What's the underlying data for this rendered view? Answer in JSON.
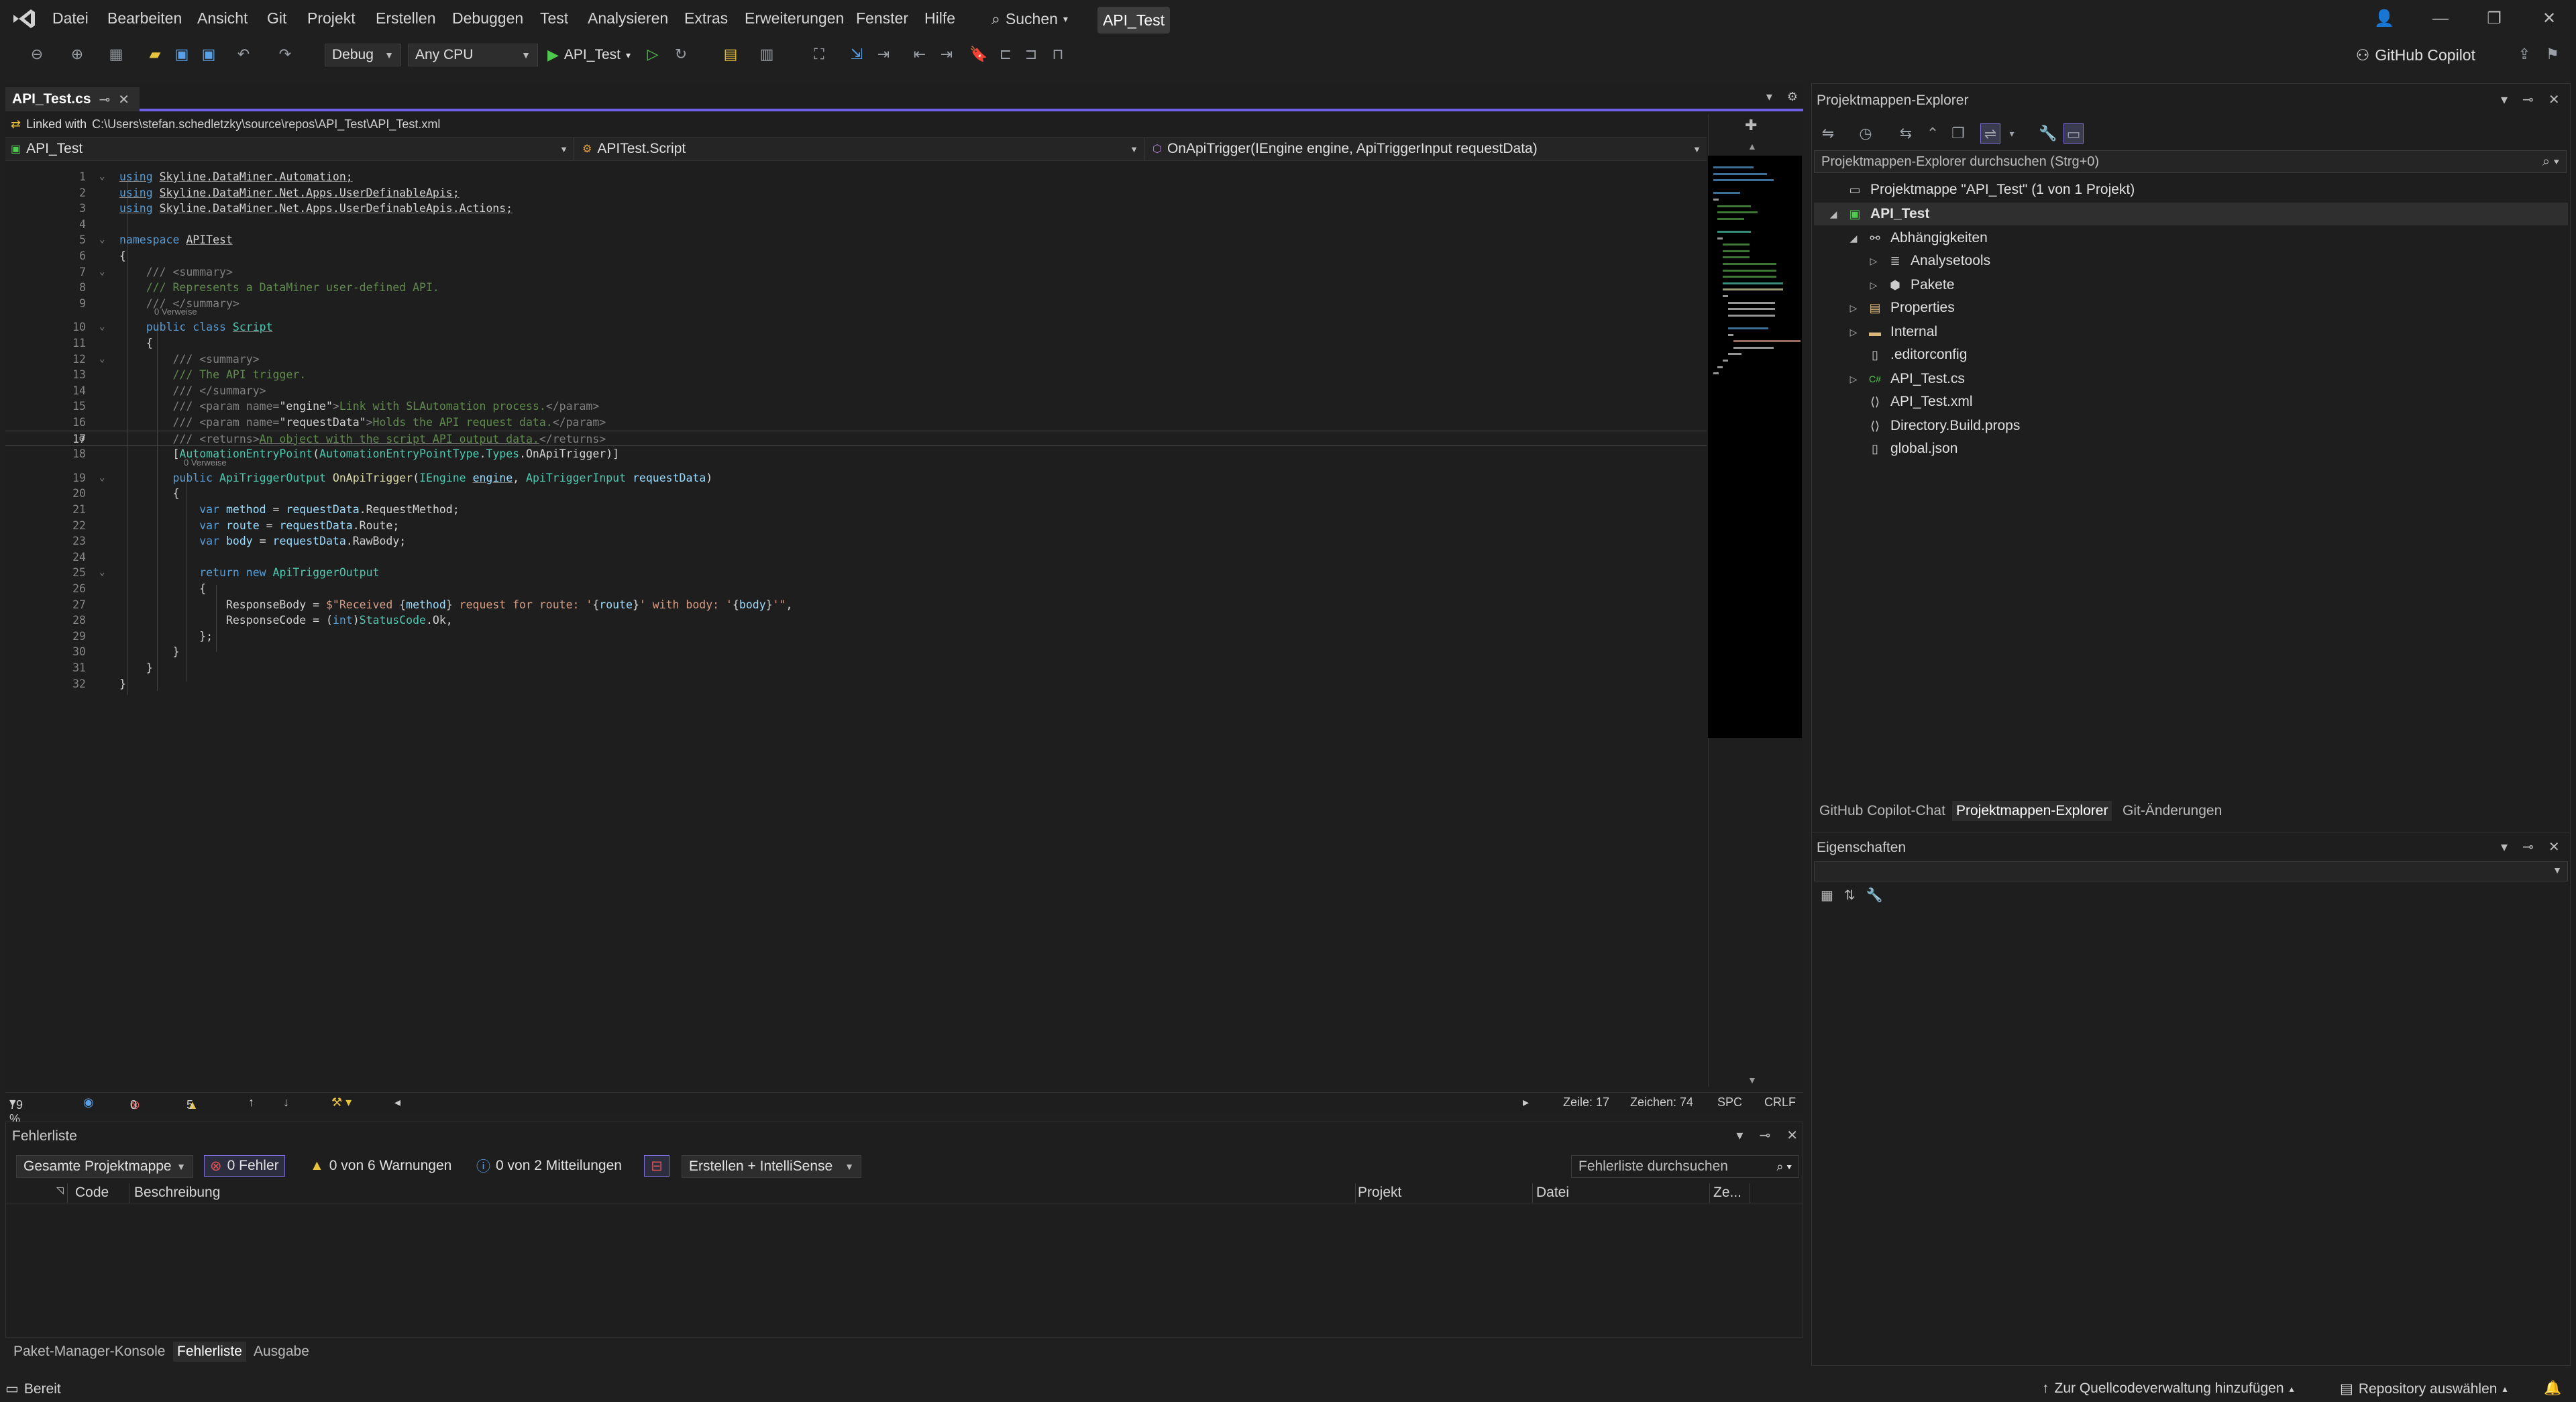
{
  "menu": {
    "items": [
      "Datei",
      "Bearbeiten",
      "Ansicht",
      "Git",
      "Projekt",
      "Erstellen",
      "Debuggen",
      "Test",
      "Analysieren",
      "Extras",
      "Erweiterungen",
      "Fenster",
      "Hilfe"
    ],
    "search_label": "Suchen",
    "project_name": "API_Test"
  },
  "toolbar": {
    "config": "Debug",
    "platform": "Any CPU",
    "run_label": "API_Test",
    "copilot_label": "GitHub Copilot"
  },
  "editor": {
    "tab_title": "API_Test.cs",
    "linked_label": "Linked with",
    "linked_path": "C:\\Users\\stefan.schedletzky\\source\\repos\\API_Test\\API_Test.xml",
    "nav_project": "API_Test",
    "nav_class": "APITest.Script",
    "nav_member": "OnApiTrigger(IEngine engine, ApiTriggerInput requestData)",
    "current_line": 17,
    "ref_label": "0 Verweise",
    "status": {
      "zoom": "79 %",
      "errors": "0",
      "warnings": "5",
      "line": "Zeile: 17",
      "char": "Zeichen: 74",
      "spc": "SPC",
      "crlf": "CRLF"
    }
  },
  "code_lines": [
    {
      "n": 1,
      "html": "<span class='kw ul'>using</span> <span class='ul'>Skyline.DataMiner.Automation;</span>"
    },
    {
      "n": 2,
      "html": "<span class='kw ul'>using</span> <span class='ul'>Skyline.DataMiner.Net.Apps.UserDefinableApis;</span>"
    },
    {
      "n": 3,
      "html": "<span class='kw ul'>using</span> <span class='ul'>Skyline.DataMiner.Net.Apps.UserDefinableApis.Actions;</span>"
    },
    {
      "n": 4,
      "html": ""
    },
    {
      "n": 5,
      "html": "<span class='kw'>namespace</span> <span class='ul'>APITest</span>"
    },
    {
      "n": 6,
      "html": "{"
    },
    {
      "n": 7,
      "html": "    <span class='xmltag'>///</span> <span class='xmltag'>&lt;summary&gt;</span>"
    },
    {
      "n": 8,
      "html": "    <span class='xml'>/// Represents a DataMiner user-defined API.</span>"
    },
    {
      "n": 9,
      "html": "    <span class='xmltag'>/// &lt;/summary&gt;</span>"
    },
    {
      "n": 10,
      "html": "    <span class='kw'>public</span> <span class='kw'>class</span> <span class='ty ul'>Script</span>"
    },
    {
      "n": 11,
      "html": "    {"
    },
    {
      "n": 12,
      "html": "        <span class='xmltag'>/// &lt;summary&gt;</span>"
    },
    {
      "n": 13,
      "html": "        <span class='xml'>/// The API trigger.</span>"
    },
    {
      "n": 14,
      "html": "        <span class='xmltag'>/// &lt;/summary&gt;</span>"
    },
    {
      "n": 15,
      "html": "        <span class='xmltag'>/// &lt;param</span> <span class='xmltag'>name=</span><span class='nm'>\"engine\"</span><span class='xmltag'>&gt;</span><span class='xml'>Link with SLAutomation process.</span><span class='xmltag'>&lt;/param&gt;</span>"
    },
    {
      "n": 16,
      "html": "        <span class='xmltag'>/// &lt;param</span> <span class='xmltag'>name=</span><span class='nm'>\"requestData\"</span><span class='xmltag'>&gt;</span><span class='xml'>Holds the API request data.</span><span class='xmltag'>&lt;/param&gt;</span>"
    },
    {
      "n": 17,
      "html": "        <span class='xmltag'>/// &lt;returns&gt;</span><span class='xml ul'>An object with the script API output data.</span><span class='xmltag'>&lt;/returns&gt;</span>"
    },
    {
      "n": 18,
      "html": "        [<span class='ty'>AutomationEntryPoint</span>(<span class='ty'>AutomationEntryPointType</span>.<span class='ty'>Types</span>.OnApiTrigger)]"
    },
    {
      "n": 19,
      "html": "        <span class='kw'>public</span> <span class='ty'>ApiTriggerOutput</span> <span class='mt'>OnApiTrigger</span>(<span class='ty'>IEngine</span> <span class='pr ul'>engine</span>, <span class='ty'>ApiTriggerInput</span> <span class='pr'>requestData</span>)"
    },
    {
      "n": 20,
      "html": "        {"
    },
    {
      "n": 21,
      "html": "            <span class='kw'>var</span> <span class='pr'>method</span> = <span class='pr'>requestData</span>.RequestMethod;"
    },
    {
      "n": 22,
      "html": "            <span class='kw'>var</span> <span class='pr'>route</span> = <span class='pr'>requestData</span>.Route;"
    },
    {
      "n": 23,
      "html": "            <span class='kw'>var</span> <span class='pr'>body</span> = <span class='pr'>requestData</span>.RawBody;"
    },
    {
      "n": 24,
      "html": ""
    },
    {
      "n": 25,
      "html": "            <span class='kw'>return</span> <span class='kw'>new</span> <span class='ty'>ApiTriggerOutput</span>"
    },
    {
      "n": 26,
      "html": "            {"
    },
    {
      "n": 27,
      "html": "                ResponseBody = <span class='str'>$\"Received </span>{<span class='pr'>method</span>}<span class='str'> request for route: '</span>{<span class='pr'>route</span>}<span class='str'>' with body: '</span>{<span class='pr'>body</span>}<span class='str'>'\"</span>,"
    },
    {
      "n": 28,
      "html": "                ResponseCode = (<span class='kw'>int</span>)<span class='ty'>StatusCode</span>.Ok,"
    },
    {
      "n": 29,
      "html": "            };"
    },
    {
      "n": 30,
      "html": "        }"
    },
    {
      "n": 31,
      "html": "    }"
    },
    {
      "n": 32,
      "html": "}"
    }
  ],
  "error_list": {
    "title": "Fehlerliste",
    "scope": "Gesamte Projektmappe",
    "errors_btn": "0 Fehler",
    "warnings_btn": "0 von 6 Warnungen",
    "messages_btn": "0 von 2 Mitteilungen",
    "source": "Erstellen + IntelliSense",
    "search_placeholder": "Fehlerliste durchsuchen",
    "columns": [
      "Code",
      "Beschreibung",
      "Projekt",
      "Datei",
      "Ze..."
    ]
  },
  "bottom_tabs": [
    "Paket-Manager-Konsole",
    "Fehlerliste",
    "Ausgabe"
  ],
  "solution_explorer": {
    "title": "Projektmappen-Explorer",
    "search_placeholder": "Projektmappen-Explorer durchsuchen (Strg+0)",
    "tree": [
      {
        "label": "Projektmappe \"API_Test\" (1 von 1 Projekt)",
        "icon": "solution-icon",
        "glyph": "▭",
        "exp": ""
      },
      {
        "label": "API_Test",
        "icon": "csharp-project-icon",
        "glyph": "▣",
        "exp": "◢"
      },
      {
        "label": "Abhängigkeiten",
        "icon": "dependencies-icon",
        "glyph": "⚯",
        "exp": "◢"
      },
      {
        "label": "Analysetools",
        "icon": "analyzer-icon",
        "glyph": "≣",
        "exp": "▷"
      },
      {
        "label": "Pakete",
        "icon": "package-icon",
        "glyph": "⬢",
        "exp": "▷"
      },
      {
        "label": "Properties",
        "icon": "properties-folder-icon",
        "glyph": "▤",
        "exp": "▷"
      },
      {
        "label": "Internal",
        "icon": "folder-icon",
        "glyph": "▬",
        "exp": "▷"
      },
      {
        "label": ".editorconfig",
        "icon": "file-icon",
        "glyph": "▯",
        "exp": ""
      },
      {
        "label": "API_Test.cs",
        "icon": "csharp-file-icon",
        "glyph": "C#",
        "exp": "▷"
      },
      {
        "label": "API_Test.xml",
        "icon": "xml-file-icon",
        "glyph": "⟨⟩",
        "exp": ""
      },
      {
        "label": "Directory.Build.props",
        "icon": "props-file-icon",
        "glyph": "⟨⟩",
        "exp": ""
      },
      {
        "label": "global.json",
        "icon": "json-file-icon",
        "glyph": "▯",
        "exp": ""
      }
    ],
    "tabs": [
      "GitHub Copilot-Chat",
      "Projektmappen-Explorer",
      "Git-Änderungen"
    ]
  },
  "properties": {
    "title": "Eigenschaften"
  },
  "statusbar": {
    "ready": "Bereit",
    "source_control": "Zur Quellcodeverwaltung hinzufügen",
    "repository": "Repository auswählen"
  }
}
